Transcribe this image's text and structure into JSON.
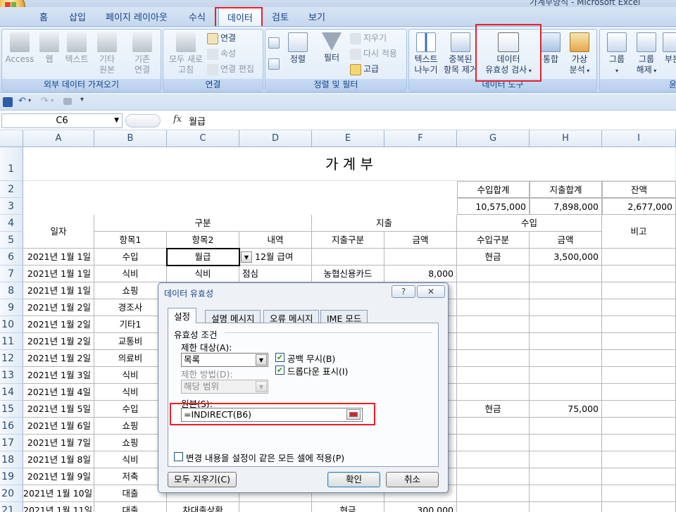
{
  "window": {
    "title": "가계부양식 - Microsoft Excel"
  },
  "tabs": [
    "홈",
    "삽입",
    "페이지 레이아웃",
    "수식",
    "데이터",
    "검토",
    "보기"
  ],
  "active_tab": "데이터",
  "ribbon": {
    "external": {
      "label": "외부 데이터 가져오기",
      "access": "Access",
      "web": "웹",
      "text": "텍스트",
      "other_1": "기타",
      "other_2": "원본",
      "existing_1": "기존",
      "existing_2": "연결"
    },
    "connections": {
      "label": "연결",
      "refresh_1": "모두 새로",
      "refresh_2": "고침",
      "connections": "연결",
      "properties": "속성",
      "edit_links": "연결 편집"
    },
    "sort_filter": {
      "label": "정렬 및 필터",
      "sort": "정렬",
      "filter": "필터",
      "clear": "지우기",
      "reapply": "다시 적용",
      "advanced": "고급"
    },
    "data_tools": {
      "label": "데이터 도구",
      "text_to_columns_1": "텍스트",
      "text_to_columns_2": "나누기",
      "remove_dup_1": "중복된",
      "remove_dup_2": "항목 제거",
      "validation_1": "데이터",
      "validation_2": "유효성 검사",
      "consolidate": "통합",
      "whatif_1": "가상",
      "whatif_2": "분석"
    },
    "outline": {
      "group_1": "그룹",
      "group_2": "",
      "ungroup_1": "그룹",
      "ungroup_2": "해제",
      "subtotal": "부분",
      "label": "윤"
    }
  },
  "formula_bar": {
    "name_box": "C6",
    "fx": "fx",
    "content": "월급"
  },
  "columns": [
    "A",
    "B",
    "C",
    "D",
    "E",
    "F",
    "G",
    "H",
    "I"
  ],
  "rows": [
    "1",
    "2",
    "3",
    "4",
    "5",
    "6",
    "7",
    "8",
    "9",
    "10",
    "11",
    "12",
    "13",
    "14",
    "15",
    "16",
    "17",
    "18",
    "19",
    "20",
    "21"
  ],
  "sheet": {
    "title": "가 계 부",
    "summary_headers": [
      "수입합계",
      "지출합계",
      "잔액"
    ],
    "summary_values": [
      "10,575,000",
      "7,898,000",
      "2,677,000"
    ],
    "date_header": "일자",
    "category_header": "구분",
    "expense_header": "지출",
    "income_header": "수입",
    "note_header": "비고",
    "sub_headers": [
      "항목1",
      "항목2",
      "내역",
      "지출구분",
      "금액",
      "수입구분",
      "금액"
    ],
    "data_rows": [
      {
        "date": "2021년 1월 1일",
        "item1": "수입",
        "item2": "월급",
        "detail": "12월 급여",
        "exp_type": "",
        "exp_amt": "",
        "inc_type": "현금",
        "inc_amt": "3,500,000"
      },
      {
        "date": "2021년 1월 1일",
        "item1": "식비",
        "item2": "식비",
        "detail": "점심",
        "exp_type": "농협신용카드",
        "exp_amt": "8,000",
        "inc_type": "",
        "inc_amt": ""
      },
      {
        "date": "2021년 1월 1일",
        "item1": "쇼핑",
        "item2": "",
        "detail": "",
        "exp_type": "",
        "exp_amt": "",
        "inc_type": "",
        "inc_amt": ""
      },
      {
        "date": "2021년 1월 2일",
        "item1": "경조사",
        "item2": "",
        "detail": "",
        "exp_type": "",
        "exp_amt": "",
        "inc_type": "",
        "inc_amt": ""
      },
      {
        "date": "2021년 1월 2일",
        "item1": "기타1",
        "item2": "",
        "detail": "",
        "exp_type": "",
        "exp_amt": "",
        "inc_type": "",
        "inc_amt": ""
      },
      {
        "date": "2021년 1월 2일",
        "item1": "교통비",
        "item2": "",
        "detail": "",
        "exp_type": "",
        "exp_amt": "",
        "inc_type": "",
        "inc_amt": ""
      },
      {
        "date": "2021년 1월 2일",
        "item1": "의료비",
        "item2": "",
        "detail": "",
        "exp_type": "",
        "exp_amt": "",
        "inc_type": "",
        "inc_amt": ""
      },
      {
        "date": "2021년 1월 3일",
        "item1": "식비",
        "item2": "",
        "detail": "",
        "exp_type": "",
        "exp_amt": "",
        "inc_type": "",
        "inc_amt": ""
      },
      {
        "date": "2021년 1월 4일",
        "item1": "식비",
        "item2": "",
        "detail": "",
        "exp_type": "",
        "exp_amt": "",
        "inc_type": "",
        "inc_amt": ""
      },
      {
        "date": "2021년 1월 5일",
        "item1": "수입",
        "item2": "",
        "detail": "",
        "exp_type": "",
        "exp_amt": "",
        "inc_type": "현금",
        "inc_amt": "75,000"
      },
      {
        "date": "2021년 1월 6일",
        "item1": "쇼핑",
        "item2": "",
        "detail": "",
        "exp_type": "",
        "exp_amt": "",
        "inc_type": "",
        "inc_amt": ""
      },
      {
        "date": "2021년 1월 7일",
        "item1": "쇼핑",
        "item2": "",
        "detail": "",
        "exp_type": "",
        "exp_amt": "",
        "inc_type": "",
        "inc_amt": ""
      },
      {
        "date": "2021년 1월 8일",
        "item1": "식비",
        "item2": "",
        "detail": "",
        "exp_type": "",
        "exp_amt": "",
        "inc_type": "",
        "inc_amt": ""
      },
      {
        "date": "2021년 1월 9일",
        "item1": "저축",
        "item2": "",
        "detail": "",
        "exp_type": "",
        "exp_amt": "",
        "inc_type": "",
        "inc_amt": ""
      },
      {
        "date": "2021년 1월 10일",
        "item1": "대출",
        "item2": "",
        "detail": "",
        "exp_type": "",
        "exp_amt": "",
        "inc_type": "",
        "inc_amt": ""
      },
      {
        "date": "2021년 1월 11일",
        "item1": "대출",
        "item2": "차대출상환",
        "detail": "",
        "exp_type": "현금",
        "exp_amt": "300,000",
        "inc_type": "",
        "inc_amt": ""
      }
    ]
  },
  "dialog": {
    "title": "데이터 유효성",
    "help": "?",
    "close": "✕",
    "tabs": [
      "설정",
      "설명 메시지",
      "오류 메시지",
      "IME 모드"
    ],
    "criteria_label": "유효성 조건",
    "allow_label": "제한 대상(A):",
    "allow_value": "목록",
    "ignore_blank": "공백 무시(B)",
    "dropdown": "드롭다운 표시(I)",
    "data_label": "제한 방법(D):",
    "data_value": "해당 범위",
    "source_label": "원본(S):",
    "source_value": "=INDIRECT(B6)",
    "apply_all": "변경 내용을 설정이 같은 모든 셀에 적용(P)",
    "clear_all": "모두 지우기(C)",
    "ok": "확인",
    "cancel": "취소"
  },
  "colors": {
    "highlight": "#e8202a",
    "ribbon_text": "#15428b"
  }
}
